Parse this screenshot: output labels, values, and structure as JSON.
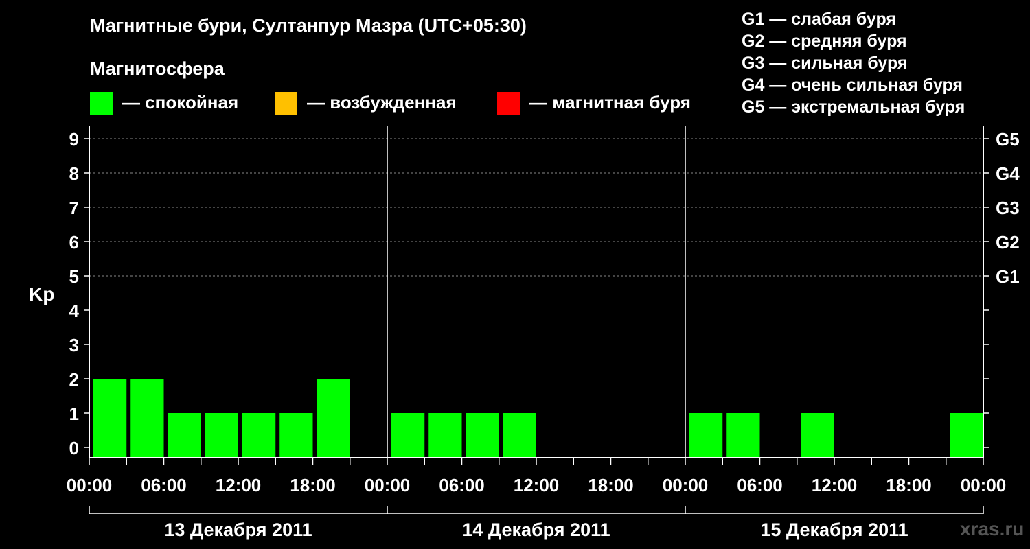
{
  "title": "Магнитные бури, Султанпур Мазра (UTC+05:30)",
  "magnetosphere": {
    "title": "Магнитосфера",
    "items": [
      {
        "label": "— спокойная",
        "color": "#00ff00"
      },
      {
        "label": "— возбужденная",
        "color": "#ffc000"
      },
      {
        "label": "— магнитная буря",
        "color": "#ff0000"
      }
    ]
  },
  "storm_levels": [
    "G1 — слабая буря",
    "G2 — средняя буря",
    "G3 — сильная буря",
    "G4 — очень сильная буря",
    "G5 — экстремальная буря"
  ],
  "watermark": "xras.ru",
  "chart_data": {
    "type": "bar",
    "ylabel": "Kp",
    "ylim": [
      0,
      9
    ],
    "yticks": [
      0,
      1,
      2,
      3,
      4,
      5,
      6,
      7,
      8,
      9
    ],
    "right_axis": [
      {
        "kp": 5,
        "label": "G1"
      },
      {
        "kp": 6,
        "label": "G2"
      },
      {
        "kp": 7,
        "label": "G3"
      },
      {
        "kp": 8,
        "label": "G4"
      },
      {
        "kp": 9,
        "label": "G5"
      }
    ],
    "x_tick_labels": [
      "00:00",
      "06:00",
      "12:00",
      "18:00",
      "00:00",
      "06:00",
      "12:00",
      "18:00",
      "00:00",
      "06:00",
      "12:00",
      "18:00",
      "00:00"
    ],
    "days": [
      "13 Декабря 2011",
      "14 Декабря 2011",
      "15 Декабря 2011"
    ],
    "interval_hours": 3,
    "grid": "dashed horizontal",
    "series": [
      {
        "color": "#00ff00",
        "values": [
          2,
          2,
          1,
          1,
          1,
          1,
          2,
          0,
          1,
          1,
          1,
          1,
          0,
          0,
          0,
          0,
          1,
          1,
          0,
          1,
          0,
          0,
          0,
          1
        ]
      }
    ]
  }
}
